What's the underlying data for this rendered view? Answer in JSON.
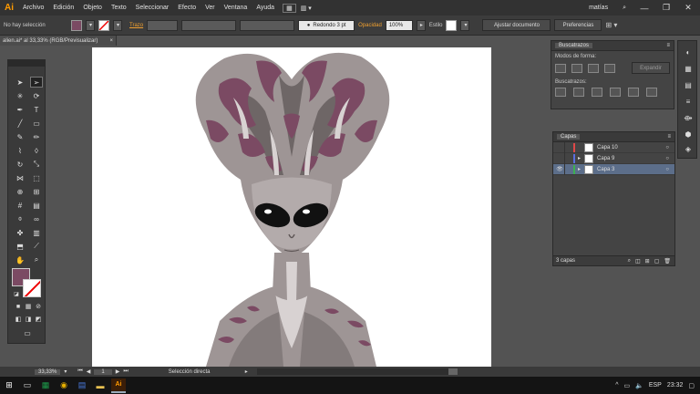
{
  "app": {
    "logo": "Ai",
    "menus": [
      "Archivo",
      "Edición",
      "Objeto",
      "Texto",
      "Seleccionar",
      "Efecto",
      "Ver",
      "Ventana",
      "Ayuda"
    ],
    "user": "matías",
    "accent": "#ff9a00"
  },
  "control_bar": {
    "selection_status": "No hay selección",
    "fill_color": "#7b4a63",
    "stroke_label": "Trazo",
    "stroke_value": "",
    "brush_label": "Redondo 3 pt",
    "opacity_label": "Opacidad",
    "opacity_value": "100%",
    "style_label": "Estilo",
    "document_setup_button": "Ajustar documento",
    "preferences_button": "Preferencias"
  },
  "document": {
    "tab_title": "alien.ai* al 33,33% (RGB/Previsualizar)"
  },
  "panels": {
    "pathfinder": {
      "tab": "Buscatrazos",
      "shape_modes_label": "Modos de forma:",
      "expand_button": "Expandir",
      "pathfinders_label": "Buscatrazos:"
    },
    "layers": {
      "tab": "Capas",
      "rows": [
        {
          "name": "Capa 10",
          "color": "#e04848",
          "visible": false,
          "expanded": false,
          "selected": false
        },
        {
          "name": "Capa 9",
          "color": "#5a6ee0",
          "visible": false,
          "expanded": true,
          "selected": false
        },
        {
          "name": "Capa 3",
          "color": "#3cb050",
          "visible": true,
          "expanded": true,
          "selected": true
        }
      ],
      "count": "3 capas"
    }
  },
  "status_bar": {
    "zoom": "33,33%",
    "artboard_number": "1",
    "tool_status": "Selección directa"
  },
  "taskbar": {
    "language": "ESP",
    "time": "23:32",
    "active_app": "Ai"
  },
  "colors": {
    "alien_purple": "#7b4a63",
    "alien_grey": "#9e9595",
    "alien_dark": "#5e5656",
    "alien_light": "#d8d2d2"
  }
}
